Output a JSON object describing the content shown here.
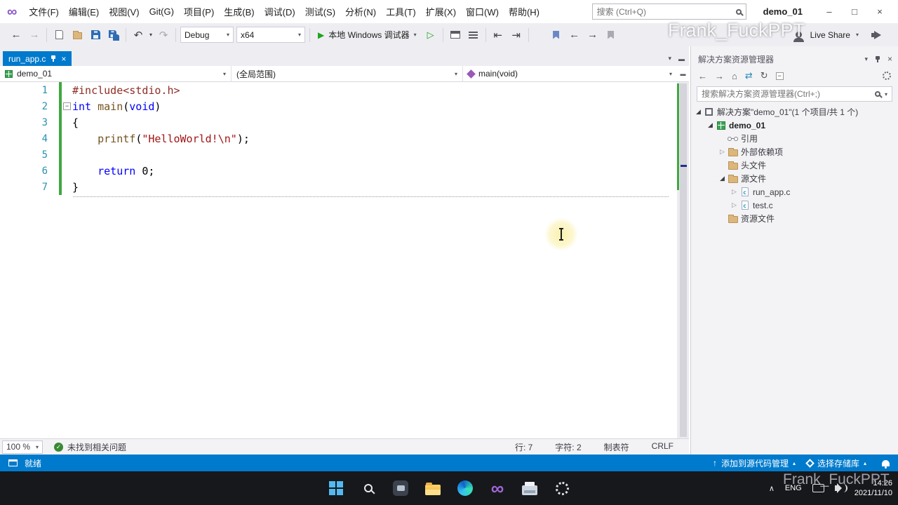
{
  "window": {
    "title": "demo_01",
    "watermark": "Frank_FuckPPT"
  },
  "menu_bar": {
    "items": [
      "文件(F)",
      "编辑(E)",
      "视图(V)",
      "Git(G)",
      "项目(P)",
      "生成(B)",
      "调试(D)",
      "测试(S)",
      "分析(N)",
      "工具(T)",
      "扩展(X)",
      "窗口(W)",
      "帮助(H)"
    ],
    "search_placeholder": "搜索 (Ctrl+Q)"
  },
  "toolbar": {
    "configuration": "Debug",
    "platform": "x64",
    "run_button": "本地 Windows 调试器",
    "live_share": "Live Share"
  },
  "editor": {
    "tab": {
      "title": "run_app.c"
    },
    "navbar": {
      "project": "demo_01",
      "scope": "(全局范围)",
      "member": "main(void)"
    },
    "code": [
      {
        "n": "1",
        "tokens": [
          {
            "t": "#include<stdio.h>",
            "c": "preproc"
          }
        ]
      },
      {
        "n": "2",
        "fold": true,
        "tokens": [
          {
            "t": "int",
            "c": "kw"
          },
          {
            "t": " ",
            "c": "pl"
          },
          {
            "t": "main",
            "c": "fn"
          },
          {
            "t": "(",
            "c": "pl"
          },
          {
            "t": "void",
            "c": "kw"
          },
          {
            "t": ")",
            "c": "pl"
          }
        ]
      },
      {
        "n": "3",
        "tokens": [
          {
            "t": "{",
            "c": "pl"
          }
        ]
      },
      {
        "n": "4",
        "tokens": [
          {
            "t": "    ",
            "c": "pl"
          },
          {
            "t": "printf",
            "c": "fn"
          },
          {
            "t": "(",
            "c": "pl"
          },
          {
            "t": "\"HelloWorld!\\n\"",
            "c": "str"
          },
          {
            "t": ");",
            "c": "pl"
          }
        ]
      },
      {
        "n": "5",
        "tokens": []
      },
      {
        "n": "6",
        "tokens": [
          {
            "t": "    ",
            "c": "pl"
          },
          {
            "t": "return",
            "c": "kw"
          },
          {
            "t": " 0;",
            "c": "pl"
          }
        ]
      },
      {
        "n": "7",
        "tokens": [
          {
            "t": "}",
            "c": "pl"
          }
        ]
      }
    ],
    "status": {
      "zoom": "100 %",
      "problems": "未找到相关问题",
      "line": "行: 7",
      "column": "字符: 2",
      "indent": "制表符",
      "eol": "CRLF"
    }
  },
  "solution_explorer": {
    "title": "解决方案资源管理器",
    "search_placeholder": "搜索解决方案资源管理器(Ctrl+;)",
    "tree": [
      {
        "label": "解决方案\"demo_01\"(1 个项目/共 1 个)",
        "indent": 0,
        "arrow": "expanded",
        "icon": "solution",
        "bold": false
      },
      {
        "label": "demo_01",
        "indent": 1,
        "arrow": "expanded",
        "icon": "project",
        "bold": true
      },
      {
        "label": "引用",
        "indent": 2,
        "arrow": "none",
        "icon": "references",
        "bold": false
      },
      {
        "label": "外部依赖项",
        "indent": 2,
        "arrow": "collapsed",
        "icon": "folder",
        "bold": false
      },
      {
        "label": "头文件",
        "indent": 2,
        "arrow": "none",
        "icon": "folder",
        "bold": false
      },
      {
        "label": "源文件",
        "indent": 2,
        "arrow": "expanded",
        "icon": "folder",
        "bold": false
      },
      {
        "label": "run_app.c",
        "indent": 3,
        "arrow": "collapsed",
        "icon": "cfile",
        "bold": false
      },
      {
        "label": "test.c",
        "indent": 3,
        "arrow": "collapsed",
        "icon": "cfile",
        "bold": false
      },
      {
        "label": "资源文件",
        "indent": 2,
        "arrow": "none",
        "icon": "folder",
        "bold": false
      }
    ]
  },
  "status_bar": {
    "message": "就绪",
    "add_to_source_control": "添加到源代码管理",
    "select_repository": "选择存储库"
  },
  "taskbar": {
    "language": "ENG",
    "time": "14:26",
    "date": "2021/11/10"
  },
  "colors": {
    "accent": "#007acc",
    "change_bar": "#40a840",
    "line_number": "#2b91af",
    "keyword": "#0000ff",
    "string": "#a31515"
  },
  "icons": {
    "back": "←",
    "forward": "→",
    "undo": "↶",
    "redo": "↷",
    "dropdown": "▾",
    "caret_up": "▴",
    "play": "▶",
    "play_outline": "▷",
    "close": "×",
    "minimize": "–",
    "maximize": "□",
    "home": "⌂",
    "refresh": "↻",
    "sync": "⇄",
    "indent": "⇥",
    "outdent": "⇤",
    "chevron_up": "∧",
    "publish": "↑",
    "vs_logo": "∞",
    "check": "✓",
    "fold_collapse": "−",
    "tree_expanded": "◢",
    "tree_collapsed": "▷",
    "window_split": "▬"
  }
}
